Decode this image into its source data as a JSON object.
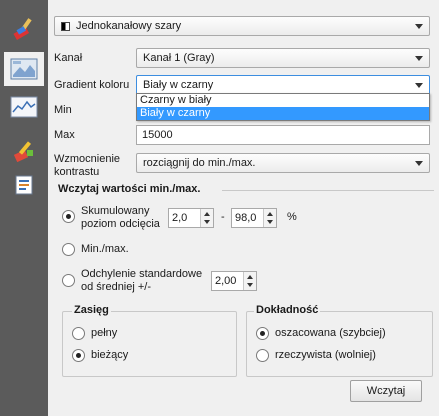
{
  "renderer": {
    "selected": "Jednokanałowy szary"
  },
  "band": {
    "label": "Kanał",
    "value": "Kanał 1 (Gray)"
  },
  "gradient": {
    "label": "Gradient koloru",
    "value": "Biały w czarny",
    "options": [
      "Czarny w biały",
      "Biały w czarny"
    ]
  },
  "min": {
    "label": "Min"
  },
  "max": {
    "label": "Max",
    "value": "15000"
  },
  "contrast": {
    "label": "Wzmocnienie kontrastu",
    "value": "rozciągnij do min./max."
  },
  "load_section": {
    "title": "Wczytaj wartości min./max.",
    "cumulative_label": "Skumulowany poziom odcięcia",
    "cumulative_low": "2,0",
    "cumulative_sep": "-",
    "cumulative_high": "98,0",
    "cumulative_unit": "%",
    "minmax_label": "Min./max.",
    "stddev_label": "Odchylenie standardowe od średniej +/-",
    "stddev_value": "2,00"
  },
  "extent": {
    "title": "Zasięg",
    "full": "pełny",
    "current": "bieżący"
  },
  "accuracy": {
    "title": "Dokładność",
    "estimate": "oszacowana (szybciej)",
    "actual": "rzeczywista (wolniej)"
  },
  "load_button": "Wczytaj",
  "colors": {
    "sidebar": "#5b5b5b",
    "highlight": "#3399ff",
    "focus": "#3d8ee0"
  },
  "icons": [
    "paint-brush-icon",
    "symbology-raster-icon",
    "histogram-icon",
    "style-brush-icon",
    "metadata-icon",
    "gradient-swatch-icon"
  ]
}
